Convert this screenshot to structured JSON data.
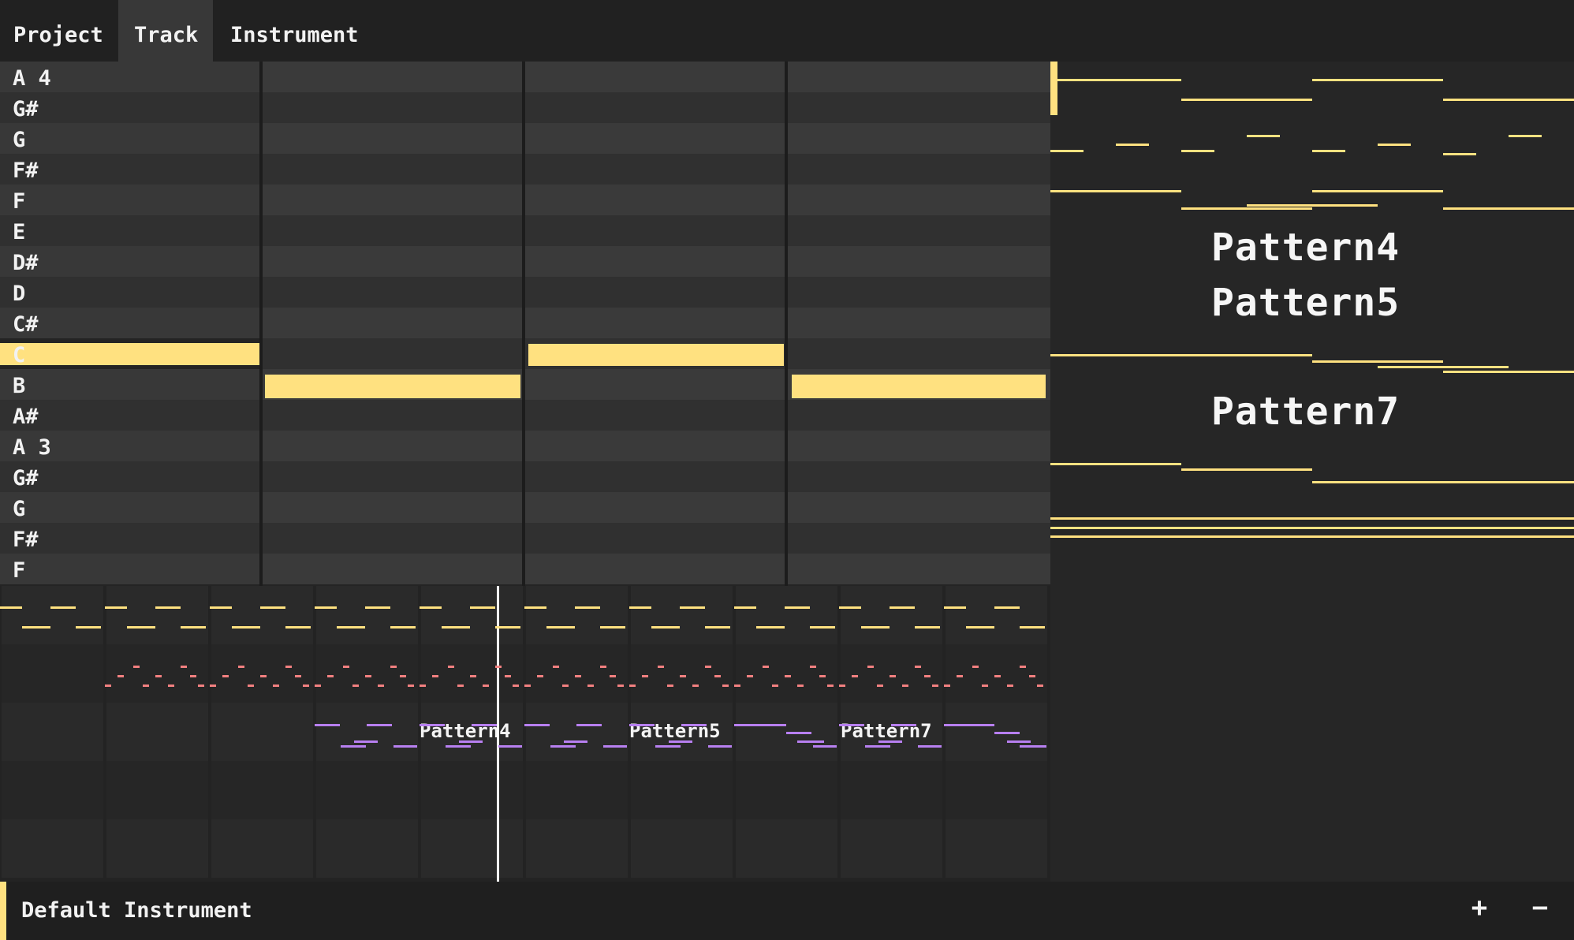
{
  "menu": {
    "project": "Project",
    "track": "Track",
    "instrument": "Instrument"
  },
  "piano": {
    "keys": [
      "A 4",
      "G#",
      "G",
      "F#",
      "F",
      "E",
      "D#",
      "D",
      "C#",
      "C",
      "B",
      "A#",
      "A 3",
      "G#",
      "G",
      "F#",
      "F"
    ],
    "highlighted_key": "C"
  },
  "song": {
    "pattern_labels": [
      "Pattern4",
      "Pattern5",
      "Pattern7"
    ]
  },
  "pattern_panel": {
    "labels": [
      "Pattern4",
      "Pattern5",
      "Pattern7"
    ]
  },
  "footer": {
    "instrument_name": "Default Instrument",
    "add_icon": "plus-icon",
    "remove_icon": "minus-icon",
    "plus_symbol": "+",
    "minus_symbol": "−"
  },
  "colors": {
    "note": "#ffe180",
    "track2": "#f28080",
    "track3": "#b77ff0",
    "accent": "#ffe180"
  }
}
